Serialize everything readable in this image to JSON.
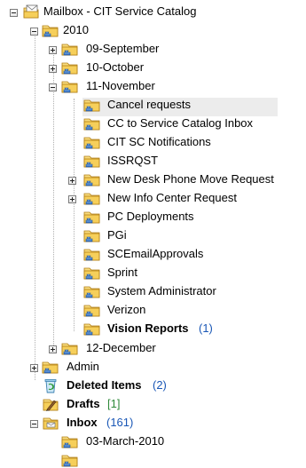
{
  "tree": {
    "root": {
      "label": "Mailbox - CIT Service Catalog",
      "icon": "mailbox-icon"
    },
    "year_2010": {
      "label": "2010"
    },
    "sep": {
      "label": "09-September"
    },
    "oct": {
      "label": "10-October"
    },
    "nov": {
      "label": "11-November"
    },
    "nov_items": [
      {
        "label": "Cancel requests"
      },
      {
        "label": "CC to Service Catalog Inbox"
      },
      {
        "label": "CIT SC Notifications"
      },
      {
        "label": "ISSRQST"
      },
      {
        "label": "New Desk Phone Move Request"
      },
      {
        "label": "New Info Center Request"
      },
      {
        "label": "PC Deployments"
      },
      {
        "label": "PGi"
      },
      {
        "label": "SCEmailApprovals"
      },
      {
        "label": "Sprint"
      },
      {
        "label": "System Administrator"
      },
      {
        "label": "Verizon"
      },
      {
        "label": "Vision Reports",
        "count": "(1)"
      }
    ],
    "dec": {
      "label": "12-December"
    },
    "admin": {
      "label": "Admin"
    },
    "deleted": {
      "label": "Deleted Items",
      "count": "(2)"
    },
    "drafts": {
      "label": "Drafts",
      "count": "[1]"
    },
    "inbox": {
      "label": "Inbox",
      "count": "(161)"
    },
    "inbox_child": {
      "label": "03-March-2010"
    }
  },
  "colors": {
    "count": "#1a57b6",
    "folder": "#f2c94c",
    "selection": "#ececec"
  }
}
